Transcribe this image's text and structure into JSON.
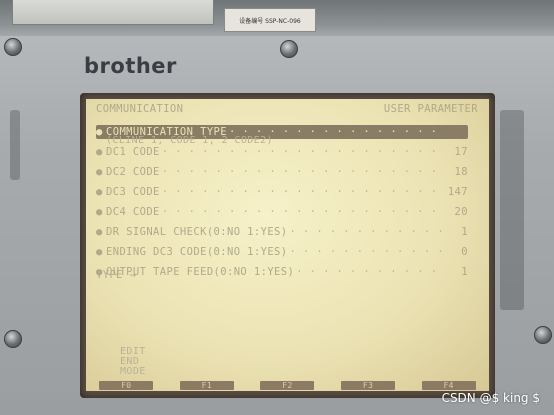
{
  "device": {
    "brand": "brother",
    "sticker_text": "设备编号 SSP-NC-096",
    "watermark": "CSDN @$ king $"
  },
  "screen": {
    "header_left": "COMMUNICATION",
    "header_right": "USER PARAMETER",
    "menu": [
      {
        "label": "COMMUNICATION TYPE",
        "value": "",
        "selected": true
      },
      {
        "label": "DC1 CODE",
        "value": "17",
        "selected": false
      },
      {
        "label": "DC2 CODE",
        "value": "18",
        "selected": false
      },
      {
        "label": "DC3 CODE",
        "value": "147",
        "selected": false
      },
      {
        "label": "DC4 CODE",
        "value": "20",
        "selected": false
      },
      {
        "label": "DR SIGNAL CHECK(0:NO 1:YES)",
        "value": "1",
        "selected": false
      },
      {
        "label": "ENDING DC3 CODE(0:NO 1:YES)",
        "value": "0",
        "selected": false
      },
      {
        "label": "OUTPUT TAPE FEED(0:NO 1:YES)",
        "value": "1",
        "selected": false
      }
    ],
    "sub_line": "(CLINE 1, CODE 1, 2 CODE2)",
    "type_prompt": "TYPE →",
    "mode_lines": [
      "EDIT",
      "END",
      "MODE"
    ],
    "function_keys": [
      "F0",
      "F1",
      "F2",
      "F3",
      "F4"
    ]
  }
}
